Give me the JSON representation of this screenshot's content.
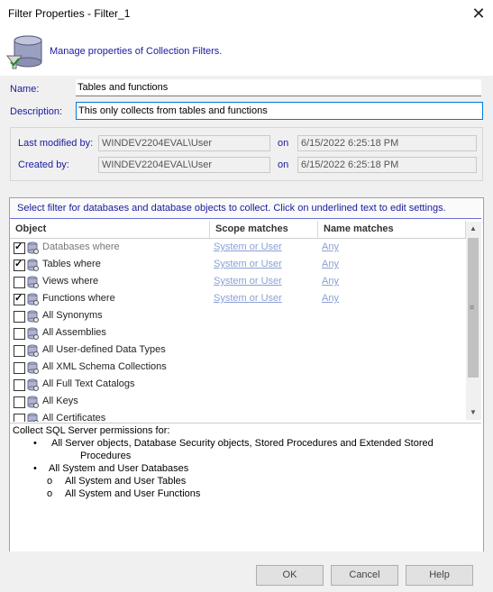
{
  "window": {
    "title": "Filter Properties - Filter_1"
  },
  "header": {
    "text": "Manage properties of Collection Filters."
  },
  "fields": {
    "name_label": "Name:",
    "name_value": "Tables and functions",
    "description_label": "Description:",
    "description_value": "This only collects from tables and functions"
  },
  "info": {
    "last_modified_label": "Last modified by:",
    "last_modified_user": "WINDEV2204EVAL\\User",
    "on1": "on",
    "last_modified_date": "6/15/2022 6:25:18 PM",
    "created_label": "Created by:",
    "created_user": "WINDEV2204EVAL\\User",
    "on2": "on",
    "created_date": "6/15/2022 6:25:18 PM"
  },
  "grid": {
    "instruction": "Select filter for databases and database objects to collect. Click on underlined text to edit settings.",
    "columns": [
      "Object",
      "Scope matches",
      "Name matches"
    ],
    "rows": [
      {
        "checked": true,
        "label": "Databases where",
        "scope": "System or User",
        "name": "Any",
        "gray": true
      },
      {
        "checked": true,
        "label": "Tables where",
        "scope": "System or User",
        "name": "Any",
        "gray": false
      },
      {
        "checked": false,
        "label": "Views where",
        "scope": "System or User",
        "name": "Any",
        "gray": false
      },
      {
        "checked": true,
        "label": "Functions where",
        "scope": "System or User",
        "name": "Any",
        "gray": false
      },
      {
        "checked": false,
        "label": "All Synonyms"
      },
      {
        "checked": false,
        "label": "All Assemblies"
      },
      {
        "checked": false,
        "label": "All User-defined Data Types"
      },
      {
        "checked": false,
        "label": "All XML Schema Collections"
      },
      {
        "checked": false,
        "label": "All Full Text Catalogs"
      },
      {
        "checked": false,
        "label": "All Keys"
      },
      {
        "checked": false,
        "label": "All Certificates"
      }
    ]
  },
  "description_panel": {
    "heading": "Collect SQL Server permissions for:",
    "bullet1_line1": "All Server objects, Database Security objects, Stored Procedures and Extended Stored",
    "bullet1_line2": "Procedures",
    "bullet2": "All System and User Databases",
    "sub1": "All System and User Tables",
    "sub2": "All System and User Functions",
    "bullet_char": "•",
    "sub_char": "o"
  },
  "buttons": {
    "ok": "OK",
    "cancel": "Cancel",
    "help": "Help"
  },
  "icons": {
    "close": "close-icon",
    "database": "database-icon",
    "scroll_up": "scroll-up-icon",
    "scroll_down": "scroll-down-icon"
  }
}
